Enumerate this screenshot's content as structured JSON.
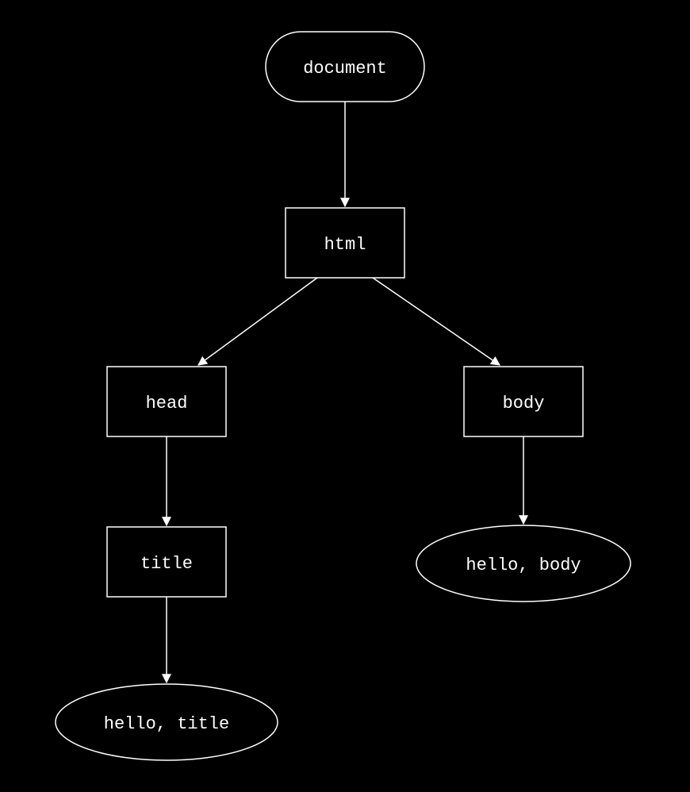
{
  "diagram": {
    "nodes": {
      "document": {
        "label": "document",
        "shape": "stadium"
      },
      "html": {
        "label": "html",
        "shape": "rect"
      },
      "head": {
        "label": "head",
        "shape": "rect"
      },
      "body": {
        "label": "body",
        "shape": "rect"
      },
      "title": {
        "label": "title",
        "shape": "rect"
      },
      "text_title": {
        "label": "hello, title",
        "shape": "ellipse"
      },
      "text_body": {
        "label": "hello, body",
        "shape": "ellipse"
      }
    },
    "edges": [
      [
        "document",
        "html"
      ],
      [
        "html",
        "head"
      ],
      [
        "html",
        "body"
      ],
      [
        "head",
        "title"
      ],
      [
        "title",
        "text_title"
      ],
      [
        "body",
        "text_body"
      ]
    ],
    "colors": {
      "background": "#000000",
      "stroke": "#ffffff",
      "text": "#ffffff"
    }
  }
}
